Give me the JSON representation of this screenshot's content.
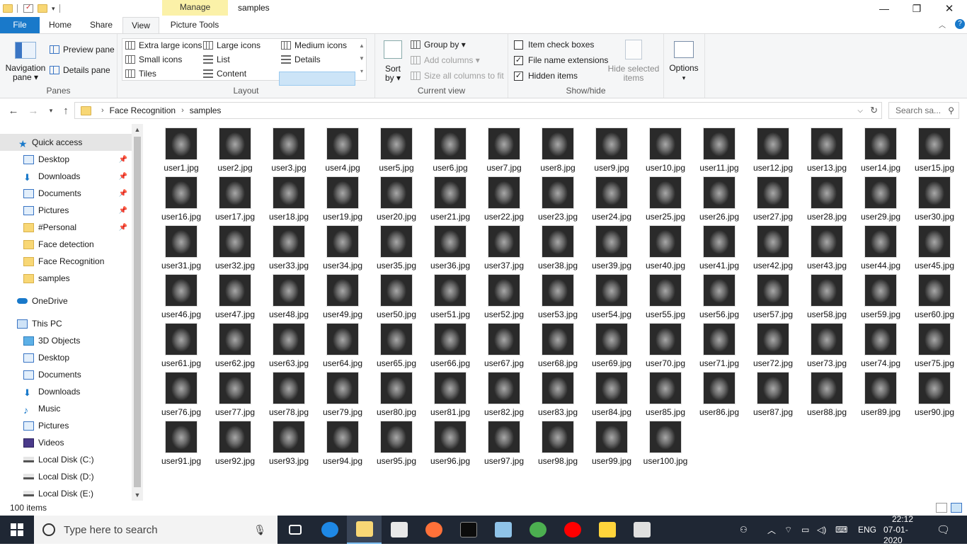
{
  "window": {
    "title": "samples",
    "context_tab": "Manage",
    "controls": {
      "minimize": "—",
      "maximize": "❐",
      "close": "✕"
    }
  },
  "ribbon_tabs": [
    "File",
    "Home",
    "Share",
    "View",
    "Picture Tools"
  ],
  "ribbon": {
    "panes": {
      "label": "Panes",
      "navigation_pane": "Navigation\npane ▾",
      "preview_pane": "Preview pane",
      "details_pane": "Details pane"
    },
    "layout": {
      "label": "Layout",
      "items": [
        "Extra large icons",
        "Large icons",
        "Medium icons",
        "Small icons",
        "List",
        "Details",
        "Tiles",
        "Content"
      ],
      "selected": "Medium icons"
    },
    "current_view": {
      "label": "Current view",
      "sort_by": "Sort\nby ▾",
      "group_by": "Group by ▾",
      "add_columns": "Add columns ▾",
      "size_columns": "Size all columns to fit"
    },
    "show_hide": {
      "label": "Show/hide",
      "item_check_boxes": "Item check boxes",
      "file_name_extensions": "File name extensions",
      "hidden_items": "Hidden items",
      "check_states": [
        false,
        true,
        true
      ],
      "hide_selected": "Hide selected\nitems"
    },
    "options": "Options"
  },
  "address": {
    "path": [
      "Face Recognition",
      "samples"
    ],
    "search_placeholder": "Search sa..."
  },
  "sidebar": {
    "quick_access": "Quick access",
    "quick_items": [
      {
        "label": "Desktop",
        "pinned": true
      },
      {
        "label": "Downloads",
        "pinned": true
      },
      {
        "label": "Documents",
        "pinned": true
      },
      {
        "label": "Pictures",
        "pinned": true
      },
      {
        "label": "#Personal",
        "pinned": true
      },
      {
        "label": "Face detection",
        "pinned": false
      },
      {
        "label": "Face Recognition",
        "pinned": false
      },
      {
        "label": "samples",
        "pinned": false
      }
    ],
    "onedrive": "OneDrive",
    "this_pc": "This PC",
    "pc_items": [
      "3D Objects",
      "Desktop",
      "Documents",
      "Downloads",
      "Music",
      "Pictures",
      "Videos",
      "Local Disk (C:)",
      "Local Disk (D:)",
      "Local Disk (E:)"
    ]
  },
  "files": [
    "user1.jpg",
    "user2.jpg",
    "user3.jpg",
    "user4.jpg",
    "user5.jpg",
    "user6.jpg",
    "user7.jpg",
    "user8.jpg",
    "user9.jpg",
    "user10.jpg",
    "user11.jpg",
    "user12.jpg",
    "user13.jpg",
    "user14.jpg",
    "user15.jpg",
    "user16.jpg",
    "user17.jpg",
    "user18.jpg",
    "user19.jpg",
    "user20.jpg",
    "user21.jpg",
    "user22.jpg",
    "user23.jpg",
    "user24.jpg",
    "user25.jpg",
    "user26.jpg",
    "user27.jpg",
    "user28.jpg",
    "user29.jpg",
    "user30.jpg",
    "user31.jpg",
    "user32.jpg",
    "user33.jpg",
    "user34.jpg",
    "user35.jpg",
    "user36.jpg",
    "user37.jpg",
    "user38.jpg",
    "user39.jpg",
    "user40.jpg",
    "user41.jpg",
    "user42.jpg",
    "user43.jpg",
    "user44.jpg",
    "user45.jpg",
    "user46.jpg",
    "user47.jpg",
    "user48.jpg",
    "user49.jpg",
    "user50.jpg",
    "user51.jpg",
    "user52.jpg",
    "user53.jpg",
    "user54.jpg",
    "user55.jpg",
    "user56.jpg",
    "user57.jpg",
    "user58.jpg",
    "user59.jpg",
    "user60.jpg",
    "user61.jpg",
    "user62.jpg",
    "user63.jpg",
    "user64.jpg",
    "user65.jpg",
    "user66.jpg",
    "user67.jpg",
    "user68.jpg",
    "user69.jpg",
    "user70.jpg",
    "user71.jpg",
    "user72.jpg",
    "user73.jpg",
    "user74.jpg",
    "user75.jpg",
    "user76.jpg",
    "user77.jpg",
    "user78.jpg",
    "user79.jpg",
    "user80.jpg",
    "user81.jpg",
    "user82.jpg",
    "user83.jpg",
    "user84.jpg",
    "user85.jpg",
    "user86.jpg",
    "user87.jpg",
    "user88.jpg",
    "user89.jpg",
    "user90.jpg",
    "user91.jpg",
    "user92.jpg",
    "user93.jpg",
    "user94.jpg",
    "user95.jpg",
    "user96.jpg",
    "user97.jpg",
    "user98.jpg",
    "user99.jpg",
    "user100.jpg"
  ],
  "status": {
    "item_count": "100 items"
  },
  "taskbar": {
    "search_placeholder": "Type here to search",
    "apps": [
      "task-view-icon",
      "edge-icon",
      "file-explorer-icon",
      "store-icon",
      "firefox-icon",
      "terminal-icon",
      "notepad-icon",
      "chrome-icon",
      "youtube-music-icon",
      "python-icon",
      "photos-icon"
    ],
    "language": "ENG",
    "time": "22:12",
    "date": "07-01-2020"
  },
  "colors": {
    "accent": "#1979ca",
    "folder": "#f8d775",
    "selection": "#cce4f7",
    "taskbar": "#1f2734"
  }
}
